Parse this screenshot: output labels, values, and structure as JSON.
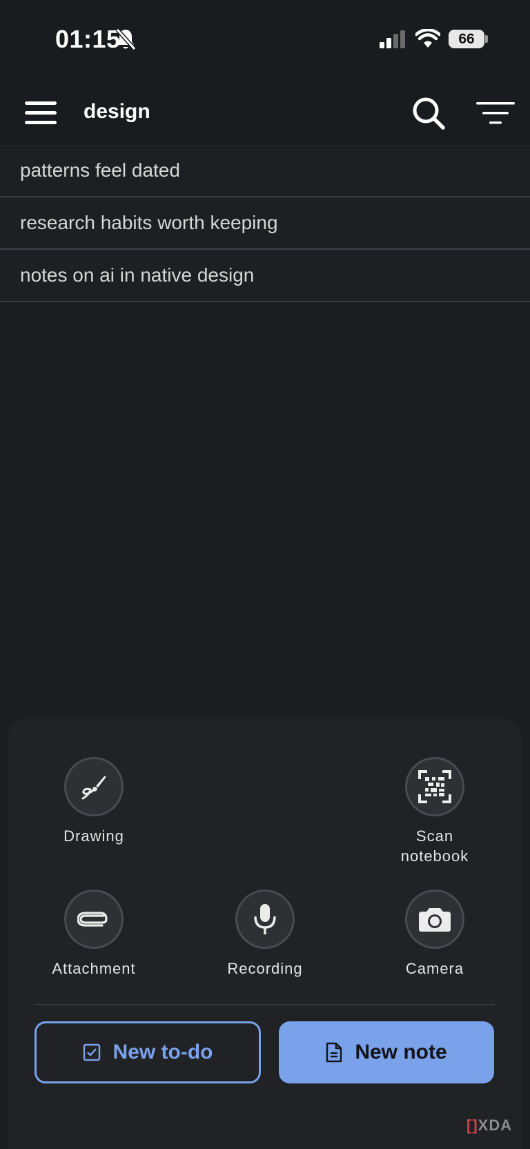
{
  "status_bar": {
    "time": "01:15",
    "battery": "66",
    "icons": [
      "bell-slash-icon",
      "signal-icon",
      "wifi-icon",
      "battery-icon"
    ]
  },
  "app_bar": {
    "title": "design",
    "icons": [
      "menu-icon",
      "search-icon",
      "filter-icon"
    ]
  },
  "notes": [
    {
      "title": "patterns feel dated"
    },
    {
      "title": "research habits worth keeping"
    },
    {
      "title": "notes on ai in native design"
    }
  ],
  "quick_actions": {
    "drawing": {
      "label": "Drawing",
      "icon": "brush-icon"
    },
    "scan": {
      "label_line1": "Scan",
      "label_line2": "notebook",
      "icon": "scan-icon"
    },
    "attachment": {
      "label": "Attachment",
      "icon": "paperclip-icon"
    },
    "recording": {
      "label": "Recording",
      "icon": "microphone-icon"
    },
    "camera": {
      "label": "Camera",
      "icon": "camera-icon"
    }
  },
  "buttons": {
    "new_todo": "New to-do",
    "new_note": "New note"
  },
  "watermark": {
    "mark": "[]",
    "text": "XDA"
  },
  "colors": {
    "accent": "#7aa2ea",
    "background": "#1b1d21",
    "sheet": "#202226"
  }
}
